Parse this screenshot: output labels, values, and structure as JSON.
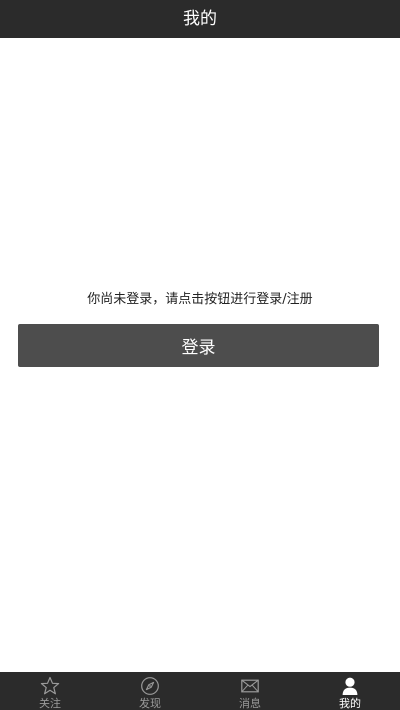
{
  "header": {
    "title": "我的"
  },
  "main": {
    "prompt_text": "你尚未登录，请点击按钮进行登录/注册",
    "login_button_label": "登录"
  },
  "tabbar": {
    "active_index": 3,
    "items": [
      {
        "label": "关注",
        "icon": "star-outline-icon"
      },
      {
        "label": "发现",
        "icon": "compass-icon"
      },
      {
        "label": "消息",
        "icon": "envelope-icon"
      },
      {
        "label": "我的",
        "icon": "person-icon"
      }
    ]
  },
  "colors": {
    "bar_background": "#2b2b2b",
    "button_background": "#4d4d4d",
    "inactive_tab": "#9a9a9a",
    "active_tab": "#ffffff"
  }
}
